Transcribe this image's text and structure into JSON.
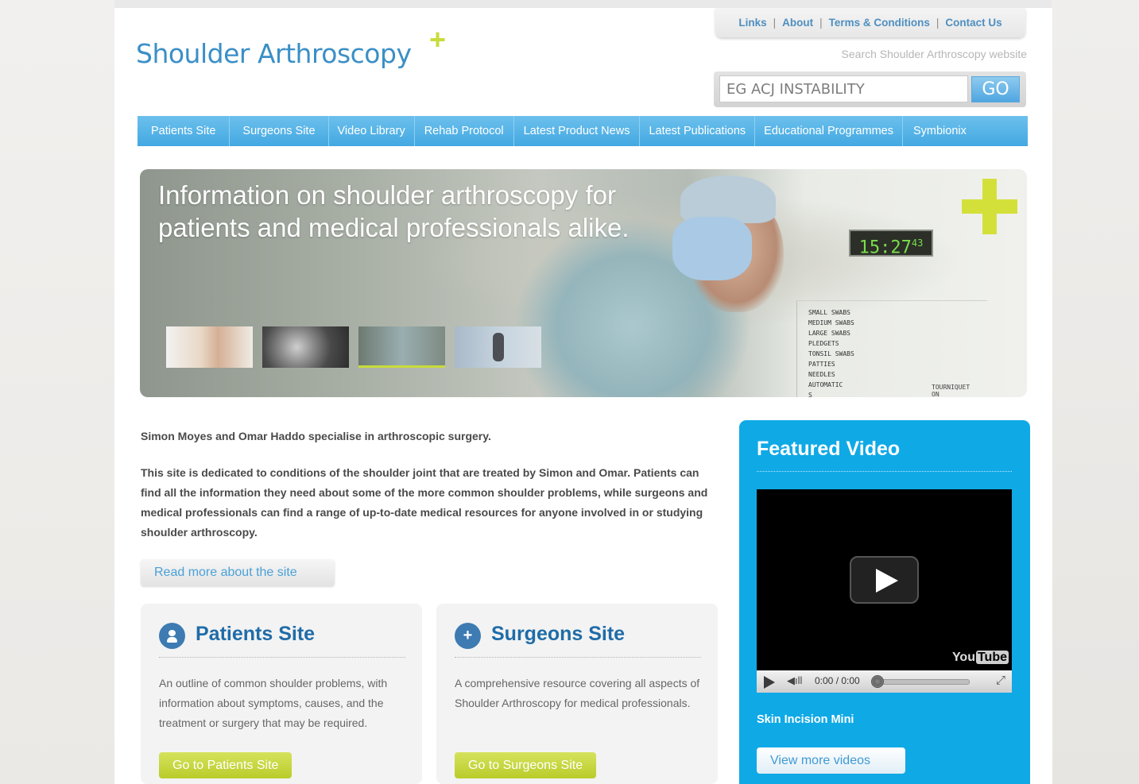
{
  "logo": {
    "text": "Shoulder Arthroscopy",
    "plus": "+"
  },
  "top_links": [
    {
      "label": "Links"
    },
    {
      "label": "About"
    },
    {
      "label": "Terms & Conditions"
    },
    {
      "label": "Contact Us"
    }
  ],
  "top_links_separator": "|",
  "search": {
    "label": "Search Shoulder Arthroscopy website",
    "value": "EG ACJ INSTABILITY",
    "button": "GO"
  },
  "nav": [
    {
      "label": "Patients Site"
    },
    {
      "label": "Surgeons Site"
    },
    {
      "label": "Video Library"
    },
    {
      "label": "Rehab Protocol"
    },
    {
      "label": "Latest Product News"
    },
    {
      "label": "Latest Publications"
    },
    {
      "label": "Educational Programmes"
    },
    {
      "label": "Symbionix"
    }
  ],
  "banner": {
    "title": "Information on shoulder arthroscopy for patients and medical professionals alike.",
    "clock": "15:27",
    "clock_seconds": "43",
    "swabs": [
      "SMALL SWABS",
      "MEDIUM SWABS",
      "LARGE SWABS",
      "PLEDGETS",
      "TONSIL SWABS",
      "PATTIES",
      "NEEDLES",
      "AUTOMATIC",
      "S"
    ],
    "tourniquet": "TOURNIQUET",
    "tourniquet_state": "ON"
  },
  "intro": {
    "line1": "Simon Moyes and Omar Haddo specialise in arthroscopic surgery.",
    "line2": "This site is dedicated to conditions of the shoulder joint that are treated by Simon and Omar. Patients can find all the information they need about some of the more common shoulder problems, while surgeons and medical professionals can find a range of up-to-date medical resources for anyone involved in or studying shoulder arthroscopy.",
    "read_more": "Read more about the site"
  },
  "cards": {
    "patients": {
      "title": "Patients Site",
      "desc": "An outline of common shoulder problems, with information about symptoms, causes, and the treatment or surgery that may be required.",
      "button": "Go to Patients Site"
    },
    "surgeons": {
      "title": "Surgeons Site",
      "icon": "+",
      "desc": "A comprehensive resource covering all aspects of Shoulder Arthroscopy for medical professionals.",
      "button": "Go to Surgeons  Site"
    }
  },
  "featured": {
    "title": "Featured Video",
    "time": "0:00 / 0:00",
    "youtube_you": "You",
    "youtube_tube": "Tube",
    "caption": "Skin Incision Mini",
    "view_more": "View more videos"
  },
  "colors": {
    "nav_blue": "#43a8e2",
    "brand_blue": "#3a8fc7",
    "accent_lime": "#c8dc3c",
    "featured_blue": "#0fa9e6"
  }
}
